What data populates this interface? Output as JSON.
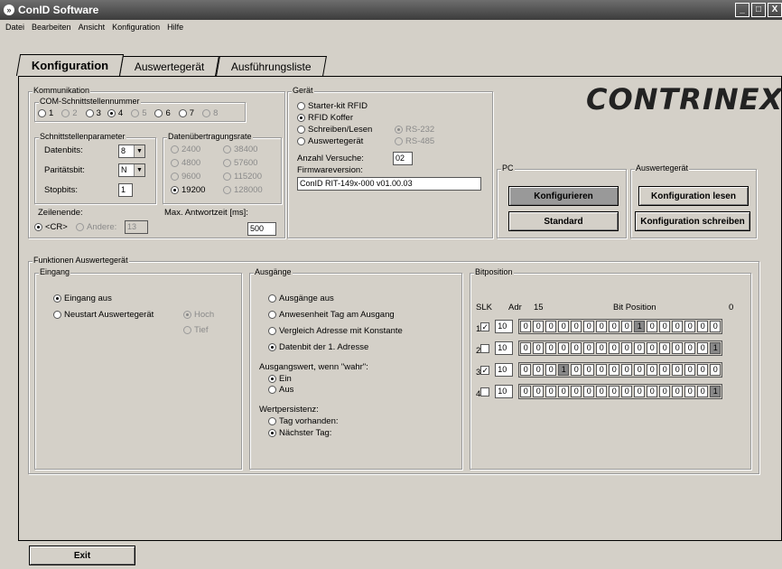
{
  "window": {
    "title": "ConID Software",
    "buttons": [
      "_",
      "□",
      "X"
    ]
  },
  "menu": [
    "Datei",
    "Bearbeiten",
    "Ansicht",
    "Konfiguration",
    "Hilfe"
  ],
  "tabs": [
    "Konfiguration",
    "Auswertegerät",
    "Ausführungsliste"
  ],
  "logo": "CONTRINEX",
  "komm": {
    "title": "Kommunikation",
    "com_title": "COM-Schnittstellennummer",
    "com_ports": [
      "1",
      "2",
      "3",
      "4",
      "5",
      "6",
      "7",
      "8"
    ],
    "com_selected": "4",
    "schnitt_title": "Schnittstellenparameter",
    "datenbits_label": "Datenbits:",
    "datenbits_value": "8",
    "paritaet_label": "Paritätsbit:",
    "paritaet_value": "N",
    "stopbits_label": "Stopbits:",
    "stopbits_value": "1",
    "rate_title": "Datenübertragungsrate",
    "rates": [
      "2400",
      "38400",
      "4800",
      "57600",
      "9600",
      "115200",
      "19200",
      "128000"
    ],
    "rate_selected": "19200",
    "zeilenende_label": "Zeilenende:",
    "zeilenende_cr": "<CR>",
    "zeilenende_andere": "Andere:",
    "zeilenende_andere_value": "13",
    "antwort_label": "Max. Antwortzeit [ms]:",
    "antwort_value": "500"
  },
  "geraet": {
    "title": "Gerät",
    "options": [
      "Starter-kit RFID",
      "RFID Koffer",
      "Schreiben/Lesen",
      "Auswertegerät"
    ],
    "selected": "RFID Koffer",
    "rs232": "RS-232",
    "rs485": "RS-485",
    "versuche_label": "Anzahl Versuche:",
    "versuche_value": "02",
    "firmware_label": "Firmwareversion:",
    "firmware_value": "ConID RIT-149x-000 v01.00.03"
  },
  "pc": {
    "title": "PC",
    "konfigurieren": "Konfigurieren",
    "standard": "Standard"
  },
  "ausw": {
    "title": "Auswertegerät",
    "lesen": "Konfiguration lesen",
    "schreiben": "Konfiguration schreiben"
  },
  "funktionen": {
    "title": "Funktionen Auswertegerät",
    "eingang": {
      "title": "Eingang",
      "aus": "Eingang aus",
      "neustart": "Neustart Auswertegerät",
      "hoch": "Hoch",
      "tief": "Tief"
    },
    "ausgaenge": {
      "title": "Ausgänge",
      "options": [
        "Ausgänge aus",
        "Anwesenheit Tag am Ausgang",
        "Vergleich Adresse mit Konstante",
        "Datenbit der 1. Adresse"
      ],
      "wahr_label": "Ausgangswert, wenn \"wahr\":",
      "ein": "Ein",
      "aus": "Aus",
      "persist_label": "Wertpersistenz:",
      "tag_vorhanden": "Tag vorhanden:",
      "naechster": "Nächster Tag:"
    },
    "bitpos": {
      "title": "Bitposition",
      "slk": "SLK",
      "adr": "Adr",
      "hi": "15",
      "bitpos_label": "Bit Position",
      "lo": "0",
      "rows": [
        {
          "slk": "1",
          "checked": true,
          "adr": "10",
          "bits": "0000000001000000"
        },
        {
          "slk": "2",
          "checked": false,
          "adr": "10",
          "bits": "0000000000000001"
        },
        {
          "slk": "3",
          "checked": true,
          "adr": "10",
          "bits": "0001000000000000"
        },
        {
          "slk": "4",
          "checked": false,
          "adr": "10",
          "bits": "0000000000000001"
        }
      ]
    }
  },
  "exit": "Exit"
}
